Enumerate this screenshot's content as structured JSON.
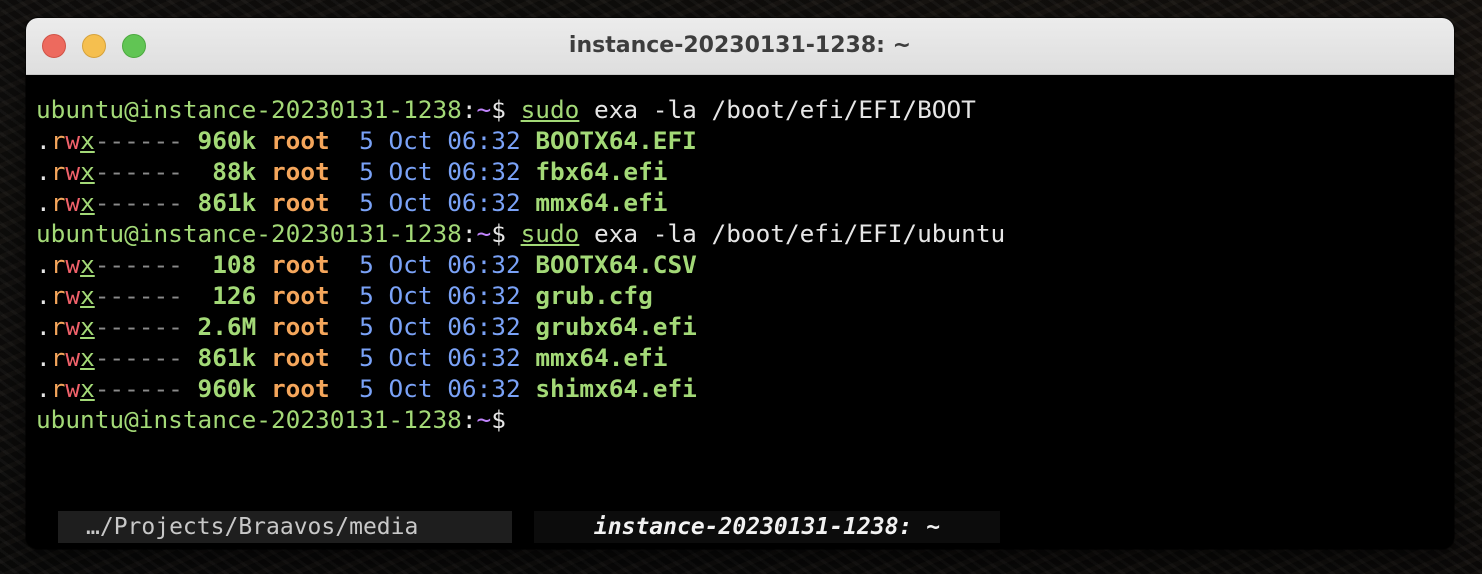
{
  "window": {
    "title": "instance-20230131-1238: ~"
  },
  "terminal": {
    "lines": [
      {
        "type": "prompt",
        "user": "ubuntu@instance-20230131-1238",
        "path": "~",
        "symbol": "$",
        "cmd": "sudo",
        "args": " exa -la /boot/efi/EFI/BOOT"
      },
      {
        "type": "entry",
        "size": "960k",
        "owner": "root",
        "day": "5",
        "month": "Oct",
        "time": "06:32",
        "name": "BOOTX64.EFI"
      },
      {
        "type": "entry",
        "size": "88k",
        "owner": "root",
        "day": "5",
        "month": "Oct",
        "time": "06:32",
        "name": "fbx64.efi"
      },
      {
        "type": "entry",
        "size": "861k",
        "owner": "root",
        "day": "5",
        "month": "Oct",
        "time": "06:32",
        "name": "mmx64.efi"
      },
      {
        "type": "prompt",
        "user": "ubuntu@instance-20230131-1238",
        "path": "~",
        "symbol": "$",
        "cmd": "sudo",
        "args": " exa -la /boot/efi/EFI/ubuntu"
      },
      {
        "type": "entry",
        "size": "108",
        "owner": "root",
        "day": "5",
        "month": "Oct",
        "time": "06:32",
        "name": "BOOTX64.CSV"
      },
      {
        "type": "entry",
        "size": "126",
        "owner": "root",
        "day": "5",
        "month": "Oct",
        "time": "06:32",
        "name": "grub.cfg"
      },
      {
        "type": "entry",
        "size": "2.6M",
        "owner": "root",
        "day": "5",
        "month": "Oct",
        "time": "06:32",
        "name": "grubx64.efi"
      },
      {
        "type": "entry",
        "size": "861k",
        "owner": "root",
        "day": "5",
        "month": "Oct",
        "time": "06:32",
        "name": "mmx64.efi"
      },
      {
        "type": "entry",
        "size": "960k",
        "owner": "root",
        "day": "5",
        "month": "Oct",
        "time": "06:32",
        "name": "shimx64.efi"
      },
      {
        "type": "prompt",
        "user": "ubuntu@instance-20230131-1238",
        "path": "~",
        "symbol": "$",
        "cmd": "",
        "args": ""
      }
    ],
    "perm": {
      "dot": ".",
      "r": "r",
      "w": "w",
      "x": "x",
      "rest": "------"
    }
  },
  "tabs": [
    {
      "label": "…/Projects/Braavos/media",
      "active": false
    },
    {
      "label": "instance-20230131-1238: ~",
      "active": true
    }
  ],
  "colors": {
    "user": "#a3d977",
    "path": "#c084fc",
    "read": "#f5a65b",
    "write": "#f0616a",
    "date": "#7aa2f7",
    "background": "#000000"
  }
}
